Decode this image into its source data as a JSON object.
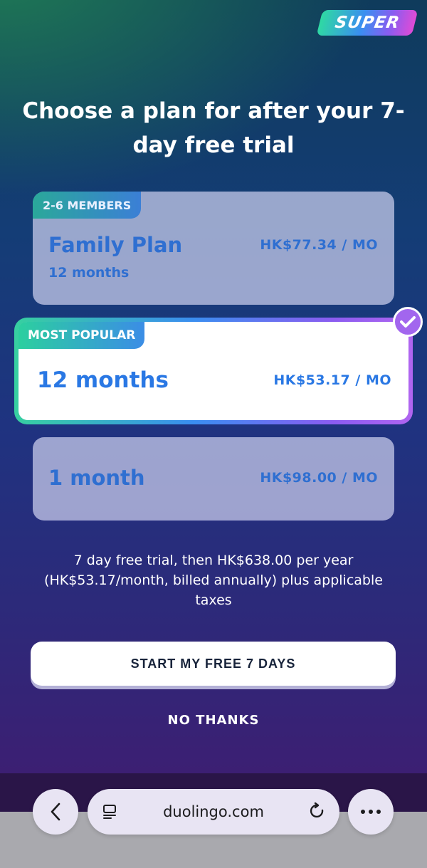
{
  "badge": {
    "label": "SUPER"
  },
  "title": "Choose a plan for after your 7-day free trial",
  "plans": {
    "family": {
      "tag": "2-6 MEMBERS",
      "name": "Family Plan",
      "duration": "12 months",
      "price": "HK$77.34 / MO"
    },
    "annual": {
      "tag": "MOST POPULAR",
      "name": "12 months",
      "price": "HK$53.17 / MO",
      "selected": true
    },
    "monthly": {
      "name": "1 month",
      "price": "HK$98.00 / MO"
    }
  },
  "trial_text": "7 day free trial, then HK$638.00 per year (HK$53.17/month, billed annually) plus applicable taxes",
  "buttons": {
    "start": "START MY FREE 7 DAYS",
    "no_thanks": "NO THANKS"
  },
  "browser": {
    "url": "duolingo.com"
  },
  "colors": {
    "accent_blue": "#2f6fd1",
    "accent_purple": "#a266ee",
    "accent_green": "#2ccf9f"
  }
}
